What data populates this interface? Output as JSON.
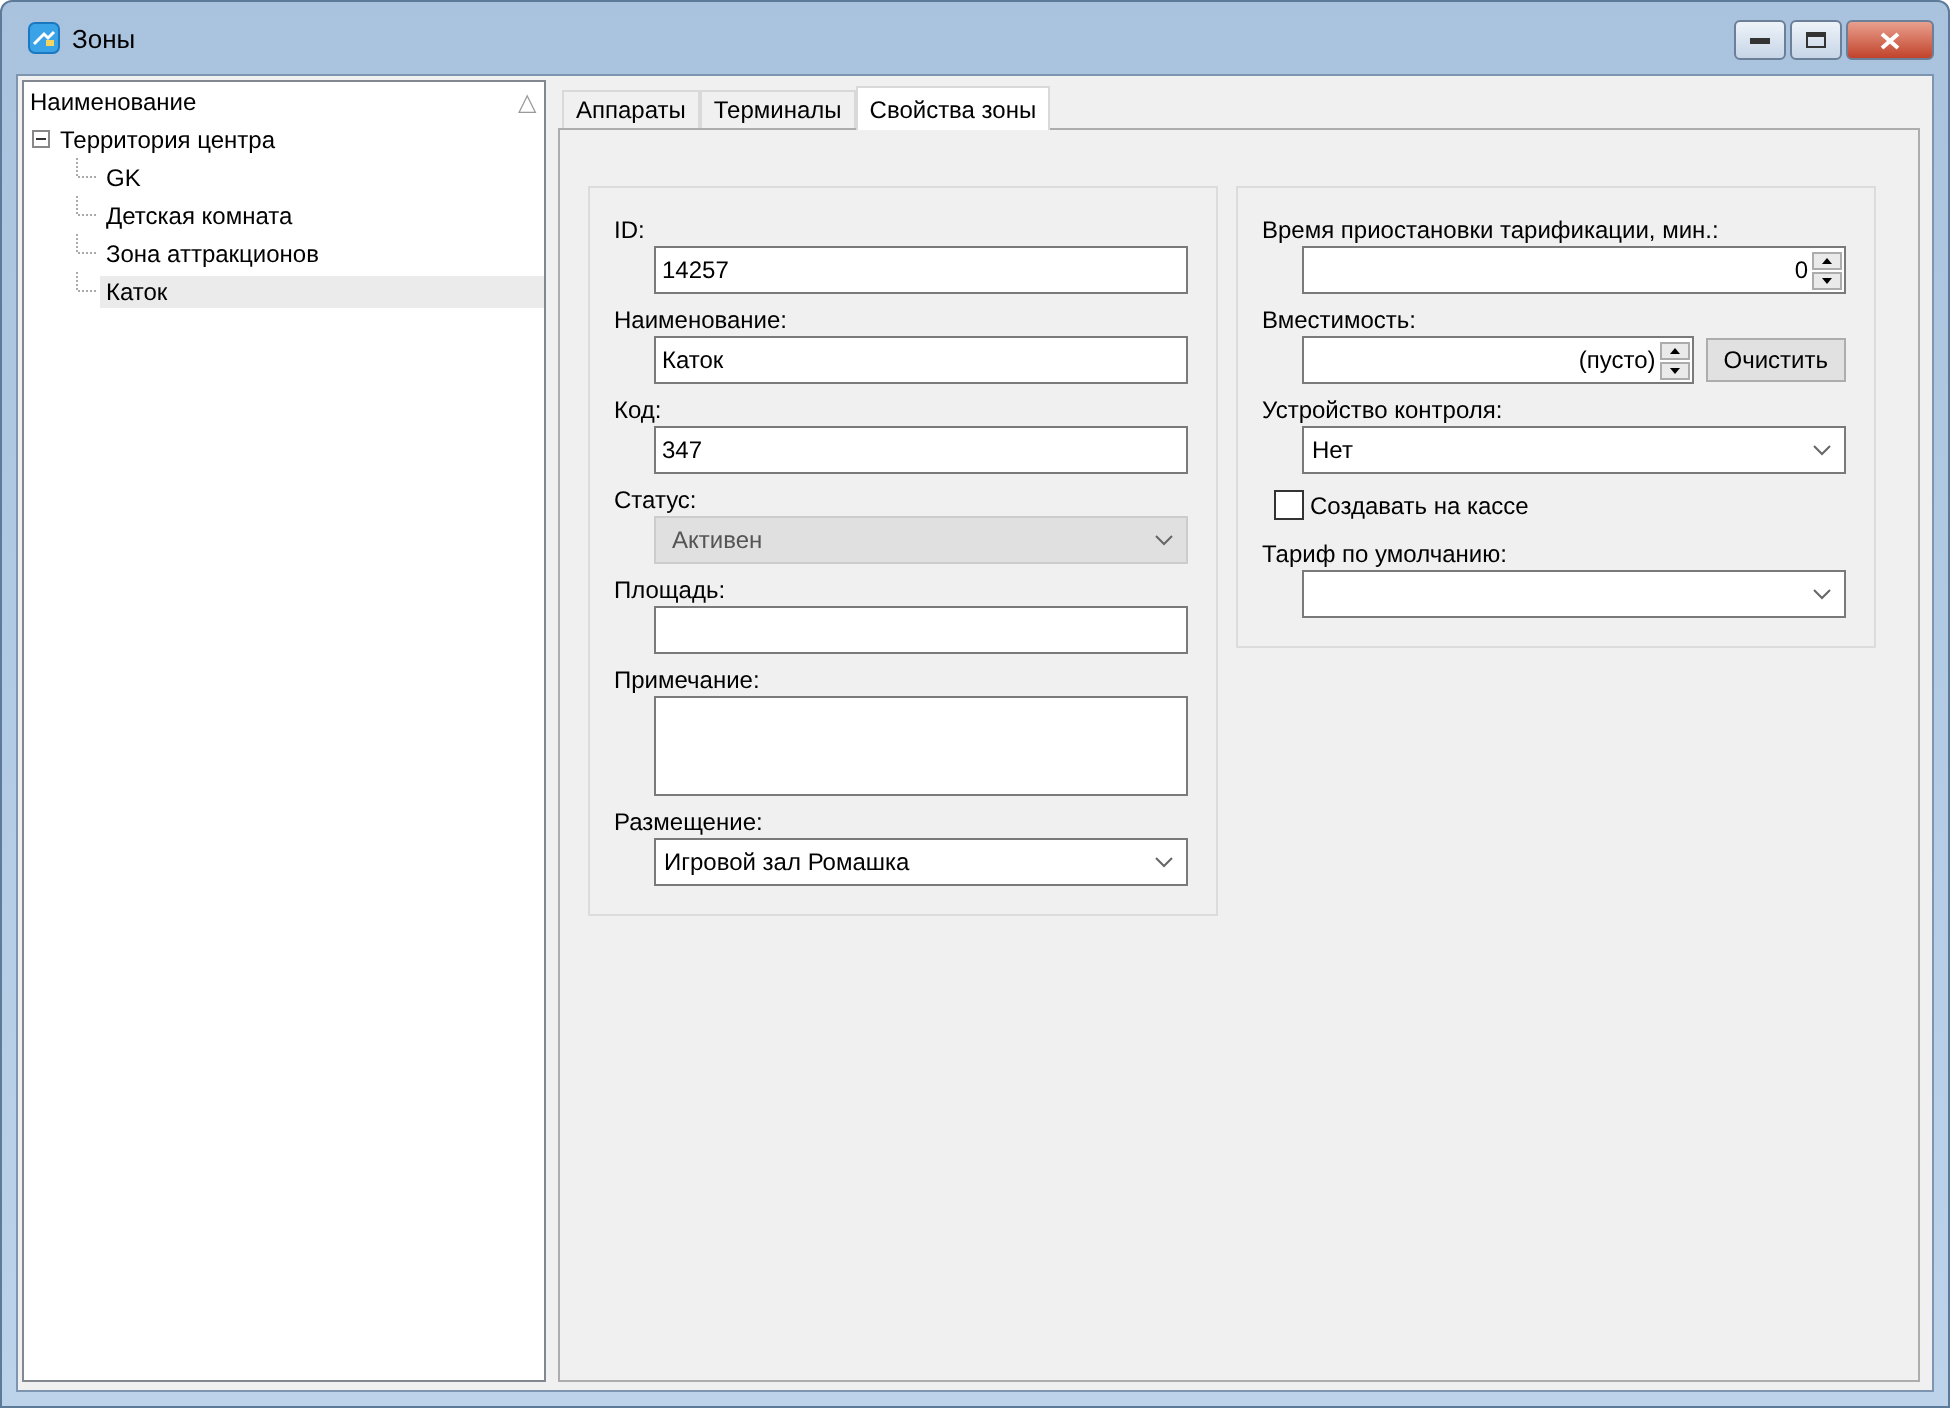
{
  "window": {
    "title": "Зоны"
  },
  "tree": {
    "header": "Наименование",
    "sort_icon": "△",
    "items": [
      {
        "label": "Территория центра",
        "expanded": true,
        "selected": false,
        "children": [
          {
            "label": "GK",
            "selected": false
          },
          {
            "label": "Детская комната",
            "selected": false
          },
          {
            "label": "Зона аттракционов",
            "selected": false
          },
          {
            "label": "Каток",
            "selected": true
          }
        ]
      }
    ]
  },
  "tabs": [
    {
      "label": "Аппараты",
      "selected": false
    },
    {
      "label": "Терминалы",
      "selected": false
    },
    {
      "label": "Свойства зоны",
      "selected": true
    }
  ],
  "left_group": [
    {
      "kind": "text",
      "label": "ID:",
      "value": "14257"
    },
    {
      "kind": "text",
      "label": "Наименование:",
      "value": "Каток"
    },
    {
      "kind": "text",
      "label": "Код:",
      "value": "347"
    },
    {
      "kind": "combo",
      "label": "Статус:",
      "value": "Активен",
      "disabled": true
    },
    {
      "kind": "text",
      "label": "Площадь:"
    },
    {
      "kind": "textarea",
      "label": "Примечание:"
    },
    {
      "kind": "combo",
      "label": "Размещение:",
      "value": "Игровой зал Ромашка",
      "disabled": false
    }
  ],
  "right_group": [
    {
      "kind": "spin",
      "label": "Время приостановки тарификации, мин.:",
      "value": "0"
    },
    {
      "kind": "spin",
      "label": "Вместимость:",
      "value": "(пусто)",
      "button": "Очистить"
    },
    {
      "kind": "combo",
      "label": "Устройство контроля:",
      "value": "Нет",
      "disabled": false
    },
    {
      "kind": "checkbox",
      "label": "Создавать на кассе",
      "checked": false
    },
    {
      "kind": "combo",
      "label": "Тариф по умолчанию:",
      "disabled": false
    }
  ]
}
